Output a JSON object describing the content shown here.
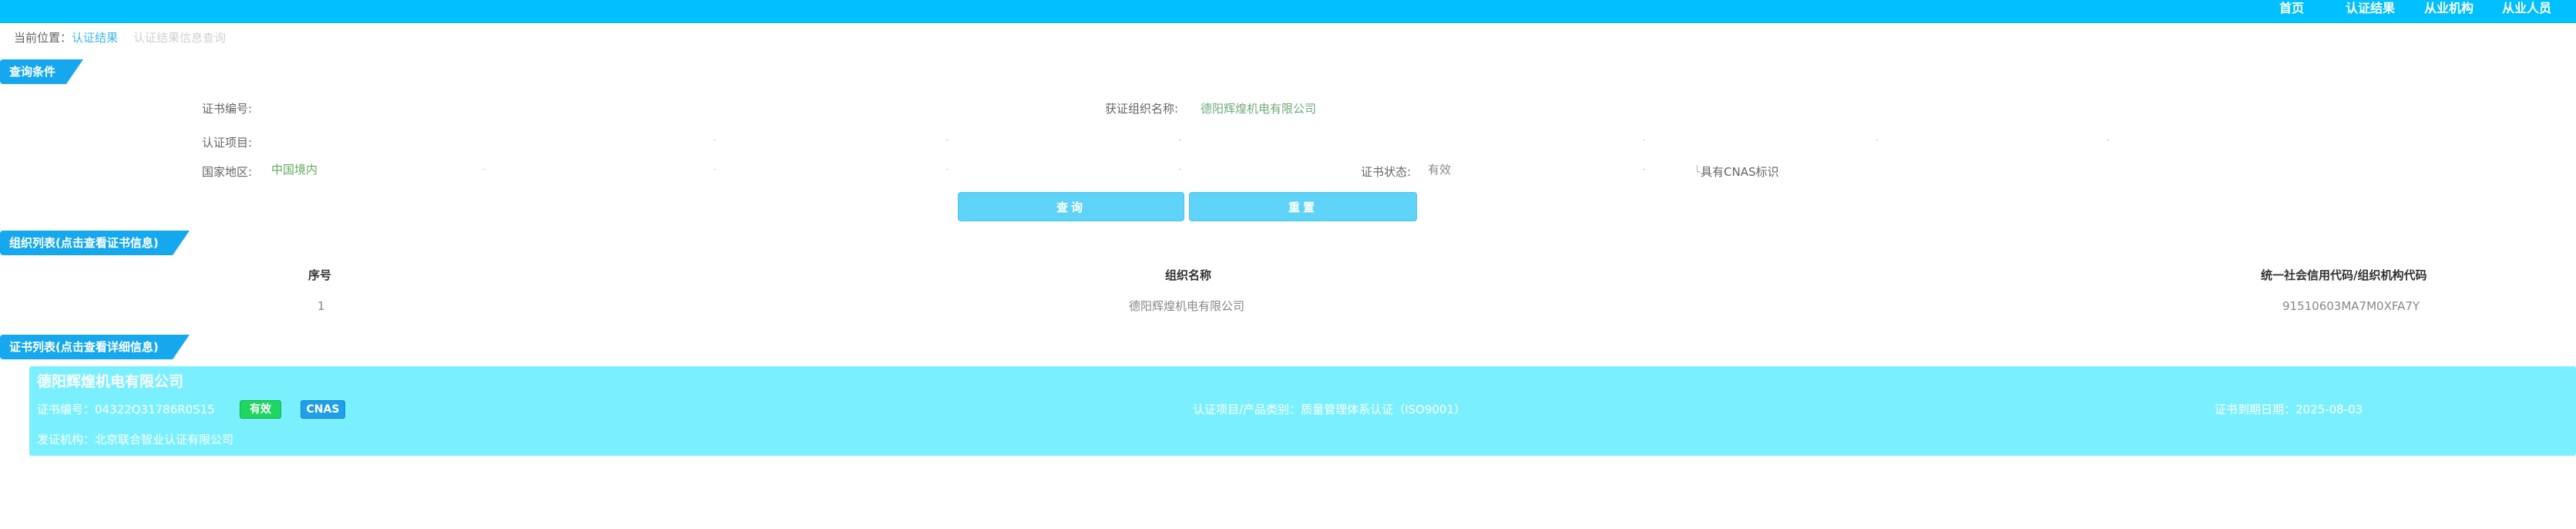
{
  "nav": {
    "home": "首页",
    "results": "认证结果",
    "agencies": "从业机构",
    "staff": "从业人员"
  },
  "breadcrumb": {
    "lead": "当前位置：",
    "link": "认证结果",
    "current": "认证结果信息查询"
  },
  "sections": {
    "query": "查询条件",
    "org_list": "组织列表(点击查看证书信息)",
    "cert_list": "证书列表(点击查看详细信息)"
  },
  "form": {
    "cert_no_label": "证书编号:",
    "cert_no_value": "",
    "org_name_label": "获证组织名称:",
    "org_name_value": "德阳辉煌机电有限公司",
    "project_label": "认证项目:",
    "region_label": "国家地区:",
    "region_value": "中国境内",
    "status_label": "证书状态:",
    "status_value": "有效",
    "cnas_label": "具有CNAS标识",
    "query_button": "查询",
    "reset_button": "重置"
  },
  "org_table": {
    "headers": [
      "序号",
      "组织名称",
      "统一社会信用代码/组织机构代码"
    ],
    "rows": [
      [
        "1",
        "德阳辉煌机电有限公司",
        "91510603MA7M0XFA7Y"
      ]
    ]
  },
  "cert_card": {
    "org_name": "德阳辉煌机电有限公司",
    "cert_no_label": "证书编号：",
    "cert_no": "04322Q31786R0S15",
    "status_badge": "有效",
    "cnas_badge": "CNAS",
    "project_label": "认证项目/产品类别：",
    "project_value": "质量管理体系认证（ISO9001）",
    "expiry_label": "证书到期日期：",
    "expiry_value": "2025-08-03",
    "issuer_label": "发证机构：",
    "issuer_value": "北京联合智业认证有限公司"
  },
  "colors": {
    "topbar": "#00c0ff",
    "ribbon": "#16a8ee",
    "button": "#5fd3f7",
    "card": "#7af0ff",
    "badge_valid": "#1ed760",
    "badge_cnas": "#1f9fe8",
    "form_value": "#5faa5f"
  }
}
